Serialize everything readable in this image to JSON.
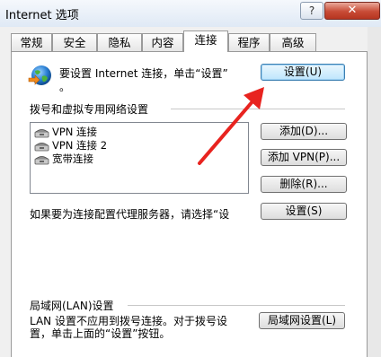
{
  "window": {
    "title": "Internet 选项",
    "help_label": "?",
    "close_label": "✕"
  },
  "tabs": [
    {
      "label": "常规"
    },
    {
      "label": "安全"
    },
    {
      "label": "隐私"
    },
    {
      "label": "内容"
    },
    {
      "label": "连接"
    },
    {
      "label": "程序"
    },
    {
      "label": "高级"
    }
  ],
  "active_tab": "连接",
  "setup": {
    "prompt_line1": "要设置 Internet 连接，单击“设置”",
    "prompt_line2": "。",
    "button_label": "设置(U)"
  },
  "dialup": {
    "heading": "拨号和虚拟专用网络设置",
    "connections": [
      {
        "label": "VPN 连接"
      },
      {
        "label": "VPN 连接 2"
      },
      {
        "label": "宽带连接"
      }
    ],
    "add_button": "添加(D)...",
    "add_vpn_button": "添加 VPN(P)...",
    "delete_button": "删除(R)...",
    "proxy_text": "如果要为连接配置代理服务器，请选择“设",
    "settings_button": "设置(S)"
  },
  "lan": {
    "heading": "局域网(LAN)设置",
    "desc_line1": "LAN 设置不应用到拨号连接。对于拨号设",
    "desc_line2": "置，单击上面的“设置”按钮。",
    "button_label": "局域网设置(L)"
  },
  "colors": {
    "arrow": "#e8231f"
  },
  "icons": {
    "setup_icon": "globe-icon",
    "connection_icon": "dialup-phone-icon"
  }
}
